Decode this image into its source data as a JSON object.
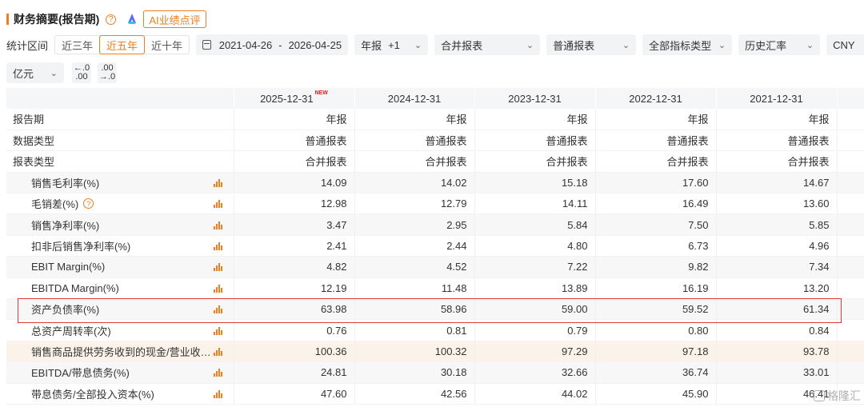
{
  "header": {
    "title": "财务摘要(报告期)",
    "ai_button": "AI业绩点评",
    "accent": "#f07d1e"
  },
  "filters": {
    "range_label": "统计区间",
    "ranges": [
      "近三年",
      "近五年",
      "近十年"
    ],
    "active_range": "近五年",
    "date_start": "2021-04-26",
    "date_sep": "-",
    "date_end": "2026-04-25",
    "report_type": "年报",
    "report_offset": "+1",
    "consolidation": "合并报表",
    "statement_type": "普通报表",
    "indicator_type": "全部指标类型",
    "exchange_rate": "历史汇率",
    "currency": "CNY"
  },
  "unit": {
    "value": "亿元",
    "dec_inc_top": "←.0",
    "dec_inc_bottom": ".00",
    "dec_dec_top": ".00",
    "dec_dec_bottom": "→.0"
  },
  "table": {
    "columns": [
      "2025-12-31",
      "2024-12-31",
      "2023-12-31",
      "2022-12-31",
      "2021-12-31"
    ],
    "new_badge": "NEW",
    "rows": [
      {
        "label": "报告期",
        "values": [
          "年报",
          "年报",
          "年报",
          "年报",
          "年报"
        ]
      },
      {
        "label": "数据类型",
        "values": [
          "普通报表",
          "普通报表",
          "普通报表",
          "普通报表",
          "普通报表"
        ]
      },
      {
        "label": "报表类型",
        "values": [
          "合并报表",
          "合并报表",
          "合并报表",
          "合并报表",
          "合并报表"
        ]
      },
      {
        "label": "销售毛利率(%)",
        "values": [
          "14.09",
          "14.02",
          "15.18",
          "17.60",
          "14.67"
        ]
      },
      {
        "label": "毛销差(%)",
        "values": [
          "12.98",
          "12.79",
          "14.11",
          "16.49",
          "13.60"
        ]
      },
      {
        "label": "销售净利率(%)",
        "values": [
          "3.47",
          "2.95",
          "5.84",
          "7.50",
          "5.85"
        ]
      },
      {
        "label": "扣非后销售净利率(%)",
        "values": [
          "2.41",
          "2.44",
          "4.80",
          "6.73",
          "4.96"
        ]
      },
      {
        "label": "EBIT Margin(%)",
        "values": [
          "4.82",
          "4.52",
          "7.22",
          "9.82",
          "7.34"
        ]
      },
      {
        "label": "EBITDA Margin(%)",
        "values": [
          "12.19",
          "11.48",
          "13.89",
          "16.19",
          "13.20"
        ]
      },
      {
        "label": "资产负债率(%)",
        "values": [
          "63.98",
          "58.96",
          "59.00",
          "59.52",
          "61.34"
        ]
      },
      {
        "label": "总资产周转率(次)",
        "values": [
          "0.76",
          "0.81",
          "0.79",
          "0.80",
          "0.84"
        ]
      },
      {
        "label": "销售商品提供劳务收到的现金/营业收入...",
        "values": [
          "100.36",
          "100.32",
          "97.29",
          "97.18",
          "93.78"
        ]
      },
      {
        "label": "EBITDA/带息债务(%)",
        "values": [
          "24.81",
          "30.18",
          "32.66",
          "36.74",
          "33.01"
        ]
      },
      {
        "label": "带息债务/全部投入资本(%)",
        "values": [
          "47.60",
          "42.56",
          "44.02",
          "45.90",
          "46.41"
        ]
      }
    ]
  },
  "watermark": "格隆汇"
}
